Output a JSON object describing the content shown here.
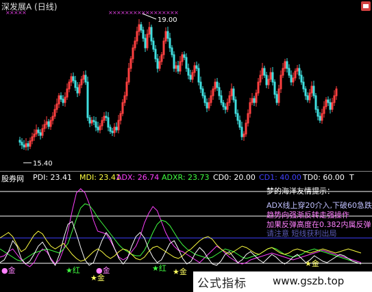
{
  "header": {
    "title": "深发展A (日线)"
  },
  "price_panel": {
    "high_label": "19.00",
    "low_label": "15.40",
    "colors": {
      "up": "#ff4040",
      "down": "#40e0e0",
      "sell_marker": "#e040e0"
    }
  },
  "indicator_bar": {
    "name": "股券网",
    "pdi": "PDI: 23.41",
    "mdi": "MDI: 23.41",
    "adx": "ADX: 26.74",
    "adxr": "ADXR: 23.73",
    "cd0": "CD0: 20.00",
    "cd1": "CD1: 40.00",
    "td0": "TD0: 60.00",
    "t": "T",
    "colors": {
      "pdi": "#ffffff",
      "mdi": "#ffff40",
      "adx": "#ff40ff",
      "adxr": "#40ff40",
      "cd0": "#ffffff",
      "cd1": "#4040ff",
      "td0": "#ffffff"
    }
  },
  "tips": {
    "title": "梦的海洋友情提示：",
    "line1": "ADX线上穿20介入,下破60急跌",
    "line2": "趋势向强渐反转走强操作",
    "line3": "加果反弹高度在0.382内属反弹",
    "line3b": "请注意 短线获利出局"
  },
  "markers": {
    "gold": "金",
    "star_gold": "★金",
    "dot_gold": "●金",
    "red": "★红"
  },
  "watermark": {
    "logo": "公式指标",
    "url": "www.gszb.top"
  }
}
